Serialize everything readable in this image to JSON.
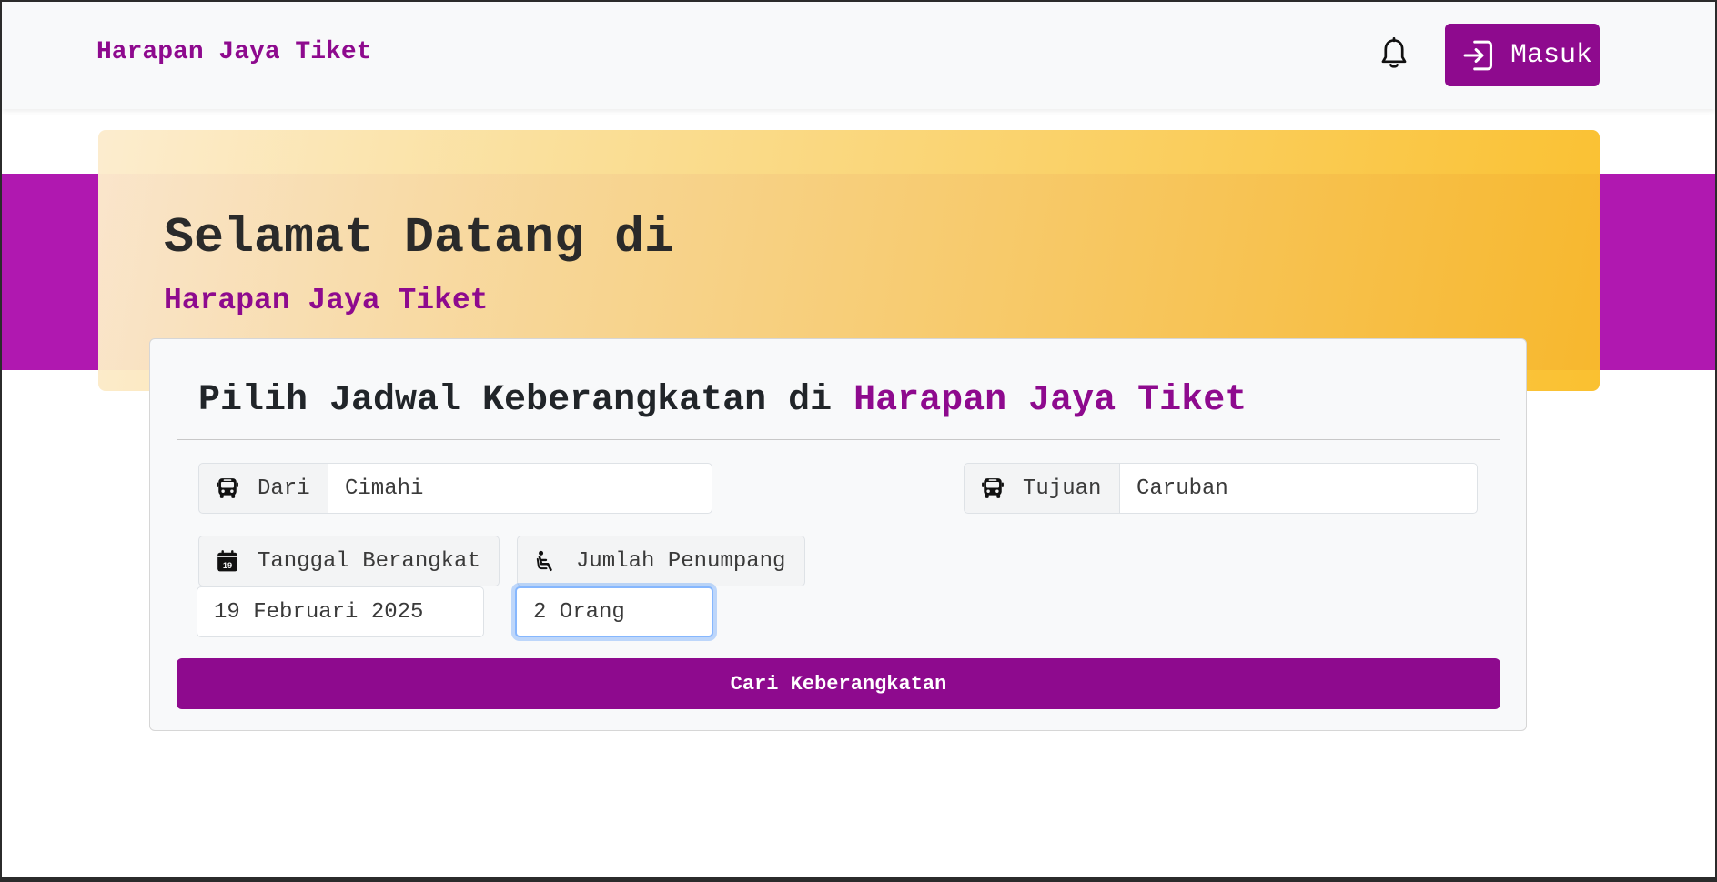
{
  "navbar": {
    "brand": "Harapan Jaya Tiket",
    "notification_icon": "bell-icon",
    "login_icon": "sign-in-icon",
    "login_label": "Masuk"
  },
  "hero": {
    "title": "Selamat Datang di",
    "subtitle": "Harapan Jaya Tiket"
  },
  "form": {
    "title_prefix": "Pilih Jadwal Keberangkatan di ",
    "title_accent": "Harapan Jaya Tiket",
    "origin": {
      "icon": "bus-icon",
      "label": "Dari",
      "value": "Cimahi"
    },
    "destination": {
      "icon": "bus-icon",
      "label": "Tujuan",
      "value": "Caruban"
    },
    "date": {
      "icon": "calendar-icon",
      "label": "Tanggal Berangkat",
      "value": "19 Februari 2025"
    },
    "passengers": {
      "icon": "seat-icon",
      "label": "Jumlah Penumpang",
      "value": "2 Orang"
    },
    "submit_label": "Cari Keberangkatan"
  },
  "colors": {
    "brand_purple": "#8e0a8e",
    "band_purple": "#b018b0",
    "hero_gold": "#fabe28"
  }
}
